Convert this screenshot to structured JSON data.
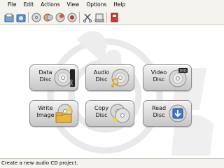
{
  "menubar": {
    "items": [
      "File",
      "Edit",
      "Actions",
      "View",
      "Options",
      "Help"
    ]
  },
  "toolbar": {
    "icons": [
      "new-project-icon",
      "open-project-icon",
      "audio-cd-icon",
      "copy-disc-icon",
      "burn-icon",
      "erase-icon",
      "cut-icon",
      "device-icon",
      "exit-icon"
    ]
  },
  "projects": {
    "data_disc": "Data\nDisc",
    "data_disc_badge": "DVD",
    "audio_disc": "Audio\nDisc",
    "video_disc": "Video\nDisc",
    "video_disc_badge": "DVD",
    "write_image": "Write\nImage",
    "copy_disc": "Copy\nDisc",
    "read_disc": "Read\nDisc"
  },
  "statusbar": {
    "text": "Create a new audio CD project."
  },
  "colors": {
    "chrome": "#f4f3ee",
    "button_top": "#f2f2f2",
    "button_bottom": "#c6c6c6",
    "watermark": "#eeeeee"
  }
}
